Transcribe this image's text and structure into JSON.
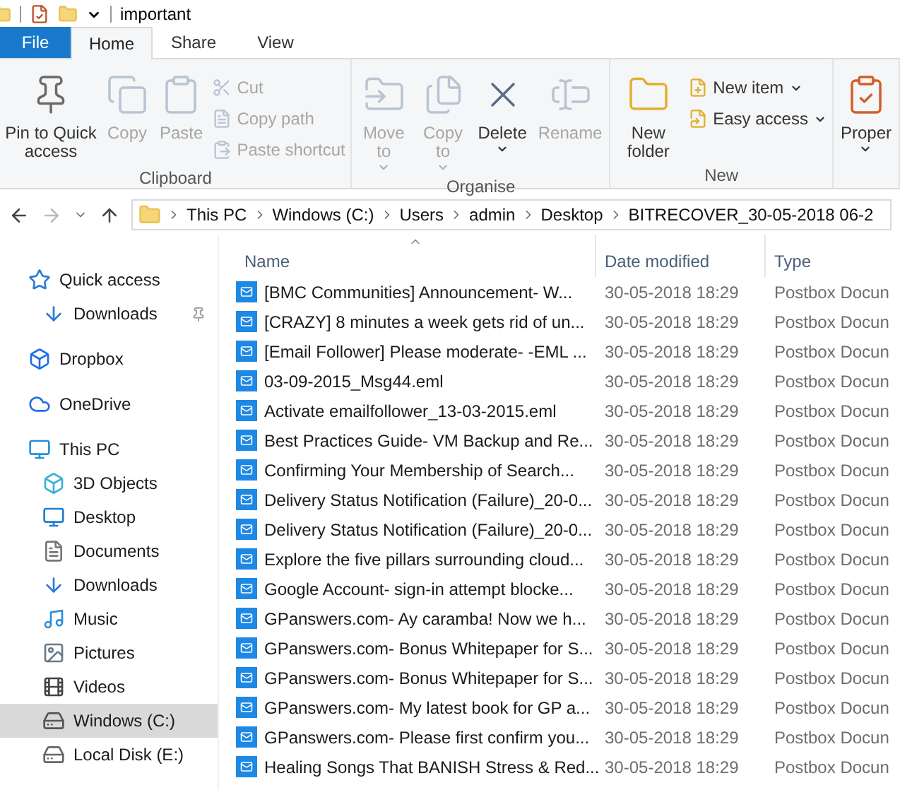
{
  "title_bar": {
    "title": "important"
  },
  "tabs": [
    {
      "label": "File",
      "kind": "file",
      "selected": false
    },
    {
      "label": "Home",
      "kind": "tab",
      "selected": true
    },
    {
      "label": "Share",
      "kind": "tab",
      "selected": false
    },
    {
      "label": "View",
      "kind": "tab",
      "selected": false
    }
  ],
  "ribbon": {
    "groups": [
      {
        "label": "Clipboard",
        "items": [
          {
            "kind": "large",
            "label": "Pin to Quick access",
            "disabled": false,
            "dropdown": false
          },
          {
            "kind": "large",
            "label": "Copy",
            "disabled": true,
            "dropdown": false
          },
          {
            "kind": "large",
            "label": "Paste",
            "disabled": true,
            "dropdown": false
          },
          {
            "kind": "small",
            "label": "Cut",
            "disabled": true,
            "dropdown": false
          },
          {
            "kind": "small",
            "label": "Copy path",
            "disabled": true,
            "dropdown": false
          },
          {
            "kind": "small",
            "label": "Paste shortcut",
            "disabled": true,
            "dropdown": false
          }
        ]
      },
      {
        "label": "Organise",
        "items": [
          {
            "kind": "large",
            "label": "Move to",
            "disabled": true,
            "dropdown": true
          },
          {
            "kind": "large",
            "label": "Copy to",
            "disabled": true,
            "dropdown": true
          },
          {
            "kind": "large",
            "label": "Delete",
            "disabled": false,
            "dropdown": true
          },
          {
            "kind": "large",
            "label": "Rename",
            "disabled": true,
            "dropdown": false
          }
        ]
      },
      {
        "label": "New",
        "items": [
          {
            "kind": "large",
            "label": "New folder",
            "disabled": false,
            "dropdown": false
          },
          {
            "kind": "small",
            "label": "New item",
            "disabled": false,
            "dropdown": true
          },
          {
            "kind": "small",
            "label": "Easy access",
            "disabled": false,
            "dropdown": true
          }
        ]
      },
      {
        "items": [
          {
            "kind": "large",
            "label": "Proper",
            "disabled": false,
            "dropdown": true
          }
        ]
      }
    ]
  },
  "address_bar": {
    "crumbs": [
      "This PC",
      "Windows (C:)",
      "Users",
      "admin",
      "Desktop",
      "BITRECOVER_30-05-2018 06-2"
    ]
  },
  "sidebar": {
    "items": [
      {
        "label": "Quick access",
        "selected": false,
        "children": [
          {
            "label": "Downloads",
            "selected": false,
            "pinned": true
          }
        ]
      },
      {
        "label": "Dropbox",
        "selected": false
      },
      {
        "label": "OneDrive",
        "selected": false
      },
      {
        "label": "This PC",
        "selected": false,
        "children": [
          {
            "label": "3D Objects",
            "selected": false
          },
          {
            "label": "Desktop",
            "selected": false
          },
          {
            "label": "Documents",
            "selected": false
          },
          {
            "label": "Downloads",
            "selected": false
          },
          {
            "label": "Music",
            "selected": false
          },
          {
            "label": "Pictures",
            "selected": false
          },
          {
            "label": "Videos",
            "selected": false
          },
          {
            "label": "Windows (C:)",
            "selected": true
          },
          {
            "label": "Local Disk (E:)",
            "selected": false
          }
        ]
      }
    ]
  },
  "table": {
    "columns": [
      {
        "label": "Name",
        "sorted": true
      },
      {
        "label": "Date modified",
        "sorted": false
      },
      {
        "label": "Type",
        "sorted": false
      }
    ],
    "rows": [
      {
        "name": "[BMC Communities] Announcement- W...",
        "date": "30-05-2018 18:29",
        "type": "Postbox Docun"
      },
      {
        "name": "[CRAZY] 8 minutes a week gets rid of un...",
        "date": "30-05-2018 18:29",
        "type": "Postbox Docun"
      },
      {
        "name": "[Email Follower] Please moderate- -EML ...",
        "date": "30-05-2018 18:29",
        "type": "Postbox Docun"
      },
      {
        "name": "03-09-2015_Msg44.eml",
        "date": "30-05-2018 18:29",
        "type": "Postbox Docun"
      },
      {
        "name": "Activate emailfollower_13-03-2015.eml",
        "date": "30-05-2018 18:29",
        "type": "Postbox Docun"
      },
      {
        "name": "Best Practices Guide- VM Backup and Re...",
        "date": "30-05-2018 18:29",
        "type": "Postbox Docun"
      },
      {
        "name": "Confirming Your Membership of Search...",
        "date": "30-05-2018 18:29",
        "type": "Postbox Docun"
      },
      {
        "name": "Delivery Status Notification (Failure)_20-0...",
        "date": "30-05-2018 18:29",
        "type": "Postbox Docun"
      },
      {
        "name": "Delivery Status Notification (Failure)_20-0...",
        "date": "30-05-2018 18:29",
        "type": "Postbox Docun"
      },
      {
        "name": "Explore the five pillars surrounding cloud...",
        "date": "30-05-2018 18:29",
        "type": "Postbox Docun"
      },
      {
        "name": "Google Account- sign-in attempt blocke...",
        "date": "30-05-2018 18:29",
        "type": "Postbox Docun"
      },
      {
        "name": "GPanswers.com- Ay caramba! Now we h...",
        "date": "30-05-2018 18:29",
        "type": "Postbox Docun"
      },
      {
        "name": "GPanswers.com- Bonus Whitepaper for S...",
        "date": "30-05-2018 18:29",
        "type": "Postbox Docun"
      },
      {
        "name": "GPanswers.com- Bonus Whitepaper for S...",
        "date": "30-05-2018 18:29",
        "type": "Postbox Docun"
      },
      {
        "name": "GPanswers.com- My latest book for GP a...",
        "date": "30-05-2018 18:29",
        "type": "Postbox Docun"
      },
      {
        "name": "GPanswers.com- Please first confirm you...",
        "date": "30-05-2018 18:29",
        "type": "Postbox Docun"
      },
      {
        "name": "Healing Songs That BANISH Stress & Red...",
        "date": "30-05-2018 18:29",
        "type": "Postbox Docun"
      }
    ]
  }
}
